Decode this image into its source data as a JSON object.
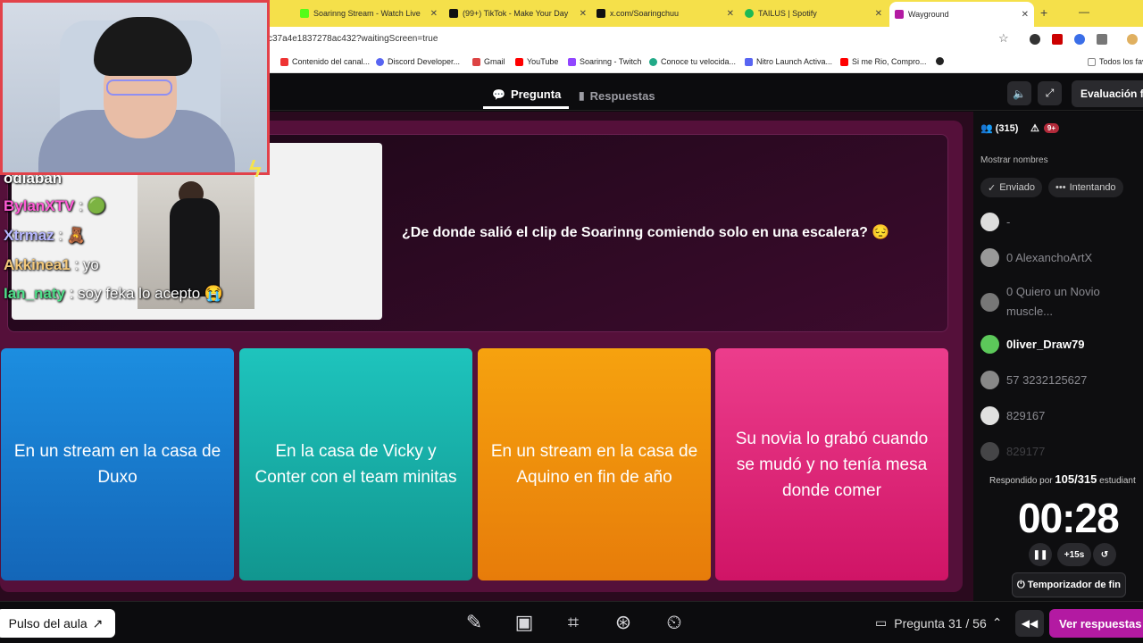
{
  "browser": {
    "tabs": [
      {
        "title": "Soarinng Stream - Watch Live",
        "color": "#53fc18"
      },
      {
        "title": "(99+) TikTok - Make Your Day",
        "color": "#111111"
      },
      {
        "title": "x.com/Soaringchuu",
        "color": "#111111"
      },
      {
        "title": "TAILUS | Spotify",
        "color": "#1db954"
      },
      {
        "title": "Wayground",
        "color": "#b31aa2"
      }
    ],
    "new_tab": "+",
    "window_control": "—",
    "url": "c37a4e1837278ac432?waitingScreen=true",
    "bookmarks": [
      {
        "label": "Contenido del canal...",
        "color": "#e33"
      },
      {
        "label": "Discord Developer...",
        "color": "#5865f2"
      },
      {
        "label": "Gmail",
        "color": "#d44"
      },
      {
        "label": "YouTube",
        "color": "#f00"
      },
      {
        "label": "Soarinng - Twitch",
        "color": "#9146ff"
      },
      {
        "label": "Conoce tu velocida...",
        "color": "#2a8"
      },
      {
        "label": "Nitro Launch Activa...",
        "color": "#5865f2"
      },
      {
        "label": "Si me Rio, Compro...",
        "color": "#f00"
      },
      {
        "label": "",
        "color": "#222"
      },
      {
        "label": "Todos los fav",
        "color": "#888"
      }
    ]
  },
  "header": {
    "tab_pregunta": "Pregunta",
    "tab_respuestas": "Respuestas",
    "evaluacion_button": "Evaluación fin"
  },
  "question": {
    "text": "¿De donde salió el clip de Soarinng comiendo solo en una escalera? 😔"
  },
  "answers": [
    {
      "text": "En un stream en la casa de Duxo",
      "color": "blue"
    },
    {
      "text": "En la casa de Vicky y Conter con el team minitas",
      "color": "teal"
    },
    {
      "text": "En un stream en la casa de Aquino en fin de año",
      "color": "orange"
    },
    {
      "text": "Su novia lo grabó cuando se mudó y no tenía mesa donde comer",
      "color": "pink"
    }
  ],
  "chat": [
    {
      "user": "odiaban",
      "message": "",
      "color": "#ffffff"
    },
    {
      "user": "BylanXTV",
      "message": " : 🟢",
      "color": "#ff5ad5"
    },
    {
      "user": "Xtrmaz",
      "message": " : 🧸",
      "color": "#b7b7ff"
    },
    {
      "user": "Akkinea1",
      "message": " : yo",
      "color": "#f2c77a"
    },
    {
      "user": "Ian_naty",
      "message": " : soy feka lo acepto 😭",
      "color": "#4fe08a"
    }
  ],
  "panel": {
    "players_count": "(315)",
    "alerts_count": "9+",
    "mostrar": "Mostrar nombres",
    "filter_enviado": "Enviado",
    "filter_intentando": "Intentando",
    "players": [
      {
        "name": "-",
        "highlight": false
      },
      {
        "name": "0 AlexanchoArtX",
        "highlight": false
      },
      {
        "name": "0 Quiero un Novio muscle...",
        "highlight": false
      },
      {
        "name": "0liver_Draw79",
        "highlight": true
      },
      {
        "name": "57 3232125627",
        "highlight": false
      },
      {
        "name": "829167",
        "highlight": false
      },
      {
        "name": "829177",
        "highlight": false
      }
    ],
    "respond_label": "Respondido por",
    "respond_count": "105/315",
    "respond_suffix": "estudiant",
    "timer": "00:28",
    "add_time": "+15s",
    "temporizador": "Temporizador de fin"
  },
  "bottom": {
    "pulso": "Pulso del aula",
    "pregunta": "Pregunta 31 / 56",
    "ver_respuestas": "Ver respuestas"
  }
}
